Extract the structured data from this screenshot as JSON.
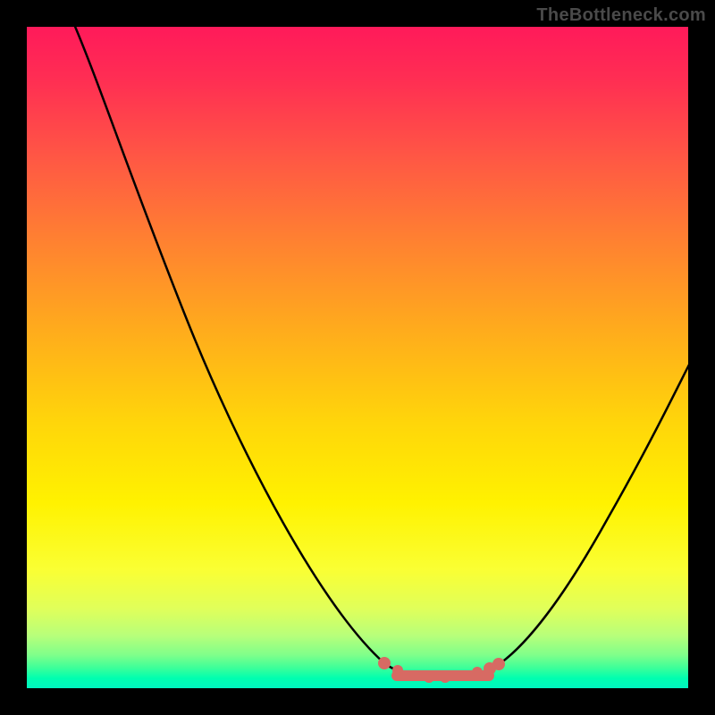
{
  "watermark": {
    "text": "TheBottleneck.com"
  },
  "chart_data": {
    "type": "line",
    "title": "",
    "xlabel": "",
    "ylabel": "",
    "xlim": [
      0,
      100
    ],
    "ylim": [
      0,
      100
    ],
    "background_gradient": {
      "top": "#ff1a5a",
      "upper_mid": "#ffac1c",
      "mid": "#fff200",
      "lower": "#7fff8a",
      "bottom": "#00f5c0"
    },
    "series": [
      {
        "name": "bottleneck-curve-left",
        "color": "#000000",
        "x": [
          7,
          12,
          18,
          24,
          30,
          36,
          42,
          48,
          52,
          55
        ],
        "y": [
          100,
          85,
          70,
          56,
          42,
          30,
          20,
          11,
          6,
          3
        ]
      },
      {
        "name": "bottleneck-curve-right",
        "color": "#000000",
        "x": [
          72,
          76,
          80,
          84,
          88,
          92,
          96,
          100
        ],
        "y": [
          3,
          8,
          14,
          21,
          29,
          38,
          48,
          58
        ]
      },
      {
        "name": "optimal-zone-dots",
        "color": "#d76a63",
        "x": [
          55,
          58,
          61,
          64,
          67,
          70,
          71,
          72
        ],
        "y": [
          3,
          1.5,
          1,
          1,
          1,
          1.5,
          2.2,
          3
        ]
      }
    ]
  }
}
